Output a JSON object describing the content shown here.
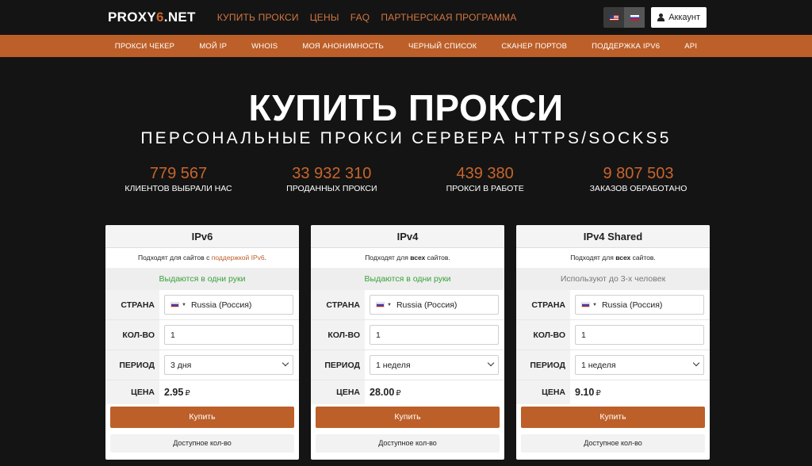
{
  "header": {
    "logo_main": "PROXY",
    "logo_six": "6",
    "logo_tail": ".NET",
    "nav": [
      "КУПИТЬ ПРОКСИ",
      "ЦЕНЫ",
      "FAQ",
      "ПАРТНЕРСКАЯ ПРОГРАММА"
    ],
    "account_label": "Аккаунт"
  },
  "subnav": [
    "ПРОКСИ ЧЕКЕР",
    "МОЙ IP",
    "WHOIS",
    "МОЯ АНОНИМНОСТЬ",
    "ЧЕРНЫЙ СПИСОК",
    "СКАНЕР ПОРТОВ",
    "ПОДДЕРЖКА IPV6",
    "API"
  ],
  "hero": {
    "title": "КУПИТЬ ПРОКСИ",
    "subtitle": "ПЕРСОНАЛЬНЫЕ ПРОКСИ СЕРВЕРА HTTPS/SOCKS5"
  },
  "stats": [
    {
      "value": "779 567",
      "label": "КЛИЕНТОВ ВЫБРАЛИ НАС"
    },
    {
      "value": "33 932 310",
      "label": "ПРОДАННЫХ ПРОКСИ"
    },
    {
      "value": "439 380",
      "label": "ПРОКСИ В РАБОТЕ"
    },
    {
      "value": "9 807 503",
      "label": "ЗАКАЗОВ ОБРАБОТАНО"
    }
  ],
  "labels": {
    "country": "СТРАНА",
    "qty": "КОЛ-ВО",
    "period": "ПЕРИОД",
    "price": "ЦЕНА",
    "buy": "Купить",
    "available": "Доступное кол-во",
    "currency": "₽"
  },
  "cards": [
    {
      "title": "IPv6",
      "desc_before": "Подходят для сайтов с ",
      "desc_em": "поддержкой IPv6",
      "desc_after": ".",
      "note": "Выдаются в одни руки",
      "country": "Russia (Россия)",
      "qty": "1",
      "period": "3 дня",
      "price": "2.95"
    },
    {
      "title": "IPv4",
      "desc_before": "Подходят для ",
      "desc_em": "всех",
      "desc_after": " сайтов.",
      "note": "Выдаются в одни руки",
      "country": "Russia (Россия)",
      "qty": "1",
      "period": "1 неделя",
      "price": "28.00"
    },
    {
      "title": "IPv4 Shared",
      "desc_before": "Подходят для ",
      "desc_em": "всех",
      "desc_after": " сайтов.",
      "note": "Используют до 3-х человек",
      "country": "Russia (Россия)",
      "qty": "1",
      "period": "1 неделя",
      "price": "9.10"
    }
  ]
}
